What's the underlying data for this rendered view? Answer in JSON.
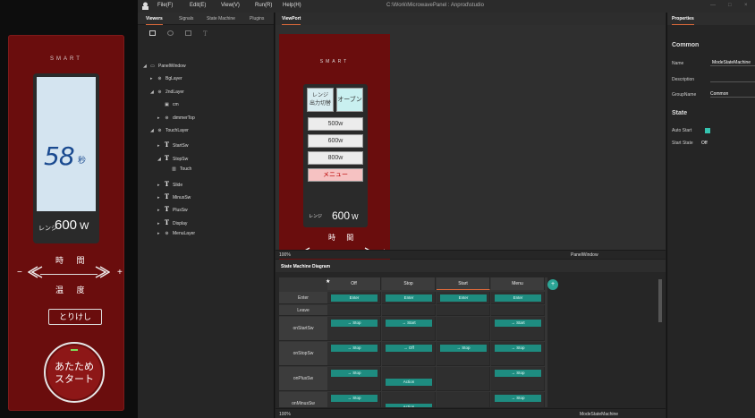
{
  "device": {
    "brand": "SMART",
    "seconds_value": "58",
    "seconds_unit": "秒",
    "mode_label": "レンジ",
    "power_value": "600",
    "power_unit": "W",
    "time_label": "時 間",
    "temp_label": "温 度",
    "minus": "−",
    "plus": "+",
    "cancel_label": "とりけし",
    "start_label_line1": "あたため",
    "start_label_line2": "スタート"
  },
  "menubar": {
    "items": [
      "File(F)",
      "Edit(E)",
      "View(V)",
      "Run(R)",
      "Help(H)"
    ],
    "window_title": "C:\\Work\\MicrowavePanel : Anprod\\studio",
    "controls": [
      "—",
      "□",
      "×"
    ]
  },
  "viewers": {
    "tabs": [
      "Viewers",
      "Signals",
      "State Machine",
      "Plugins"
    ],
    "tree": [
      {
        "label": "PanelWindow",
        "icon": "window",
        "arrow": "◢",
        "indent": 0
      },
      {
        "label": "BgLayer",
        "icon": "layer",
        "arrow": "▸",
        "indent": 1
      },
      {
        "label": "2ndLayer",
        "icon": "layer",
        "arrow": "◢",
        "indent": 1
      },
      {
        "label": "cm",
        "icon": "image",
        "arrow": "",
        "indent": 2
      },
      {
        "label": "dimmerTop",
        "icon": "layer",
        "arrow": "▸",
        "indent": 2
      },
      {
        "label": "TouchLayer",
        "icon": "layer",
        "arrow": "◢",
        "indent": 1
      },
      {
        "label": "StartSw",
        "icon": "T",
        "arrow": "▸",
        "indent": 2
      },
      {
        "label": "StopSw",
        "icon": "T",
        "arrow": "◢",
        "indent": 2
      },
      {
        "label": "Touch",
        "icon": "touch",
        "arrow": "",
        "indent": 3
      },
      {
        "label": "Slide",
        "icon": "T",
        "arrow": "▸",
        "indent": 2
      },
      {
        "label": "MinusSw",
        "icon": "T",
        "arrow": "▸",
        "indent": 2
      },
      {
        "label": "PlusSw",
        "icon": "T",
        "arrow": "▸",
        "indent": 2
      },
      {
        "label": "Display",
        "icon": "T",
        "arrow": "▸",
        "indent": 2
      },
      {
        "label": "MenuLayer",
        "icon": "layer",
        "arrow": "▸",
        "indent": 2
      }
    ]
  },
  "viewport": {
    "tab": "ViewPort",
    "brand": "SMART",
    "tile_range": "レンジ\n出力切替",
    "tile_oven": "オーブン",
    "buttons": [
      "500w",
      "600w",
      "800w"
    ],
    "menu_button": "メニュー",
    "mode_label": "レンジ",
    "power_value": "600",
    "power_unit": "W",
    "time_label": "時 間",
    "zoom": "100%",
    "layer_name": "PanelWindow"
  },
  "properties": {
    "tab": "Properties",
    "section_common": "Common",
    "name_label": "Name",
    "name_value": "ModeStateMachine",
    "description_label": "Description",
    "groupname_label": "GroupName",
    "groupname_value": "Common",
    "section_state": "State",
    "autostart_label": "Auto Start",
    "startstate_label": "Start State",
    "startstate_value": "Off"
  },
  "smd": {
    "tab": "State Machine Diagram",
    "columns": [
      "Off",
      "Stop",
      "Start",
      "Menu"
    ],
    "rows": [
      {
        "label": "Enter",
        "cells": [
          [
            "Enter"
          ],
          [
            "Enter"
          ],
          [
            "Enter"
          ],
          [
            "Enter"
          ]
        ]
      },
      {
        "label": "Leave",
        "cells": [
          [],
          [],
          [],
          []
        ]
      },
      {
        "label": "onStartSw",
        "cells": [
          [
            "→ Stop"
          ],
          [
            "→ Start"
          ],
          [],
          [
            "→ Start"
          ]
        ]
      },
      {
        "label": "onStopSw",
        "cells": [
          [
            "→ Stop"
          ],
          [
            "→ Off"
          ],
          [
            "→ Stop"
          ],
          [
            "→ Stop"
          ]
        ]
      },
      {
        "label": "onPlusSw",
        "cells": [
          [
            "→ Stop"
          ],
          [
            "Action"
          ],
          [],
          [
            "→ Stop"
          ]
        ]
      },
      {
        "label": "onMinusSw",
        "cells": [
          [
            "→ Stop"
          ],
          [
            "Action"
          ],
          [],
          [
            "→ Stop"
          ]
        ]
      }
    ],
    "zoom": "100%",
    "machine_name": "ModeStateMachine"
  },
  "colors": {
    "accent": "#e06a3a",
    "teal": "#1e8c80",
    "device_red": "#6a0d0d",
    "lcd": "#d4e4f0"
  }
}
